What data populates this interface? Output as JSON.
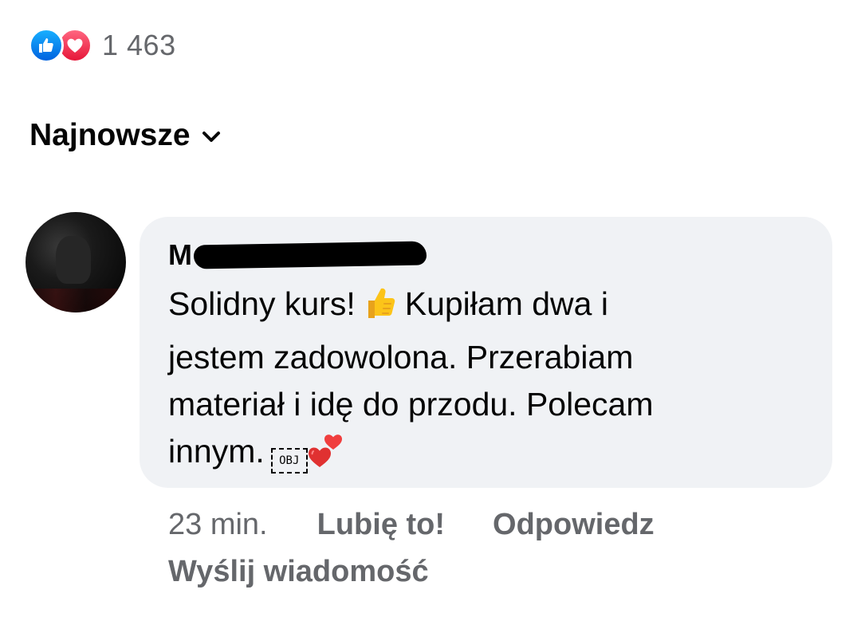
{
  "reactions": {
    "icons": [
      "like-icon",
      "love-icon"
    ],
    "count": "1 463",
    "colors": {
      "like": "#1877f2",
      "love": "#f33e58"
    }
  },
  "sort": {
    "label": "Najnowsze",
    "icon": "chevron-down-icon"
  },
  "comment": {
    "author_initial": "M",
    "author_redacted": true,
    "line1_a": "Solidny kurs!",
    "line1_b": "Kupiłam dwa i",
    "line2": "jestem zadowolona. Przerabiam",
    "line3": "materiał i idę do przodu. Polecam",
    "line4": "innym.",
    "obj_placeholder": "OBJ",
    "emojis": [
      "thumbs-up-emoji",
      "two-hearts-emoji"
    ],
    "bubble_color": "#f0f2f5"
  },
  "actions": {
    "time": "23 min.",
    "like_label": "Lubię to!",
    "reply_label": "Odpowiedz",
    "message_label": "Wyślij wiadomość",
    "color": "#65676b"
  }
}
